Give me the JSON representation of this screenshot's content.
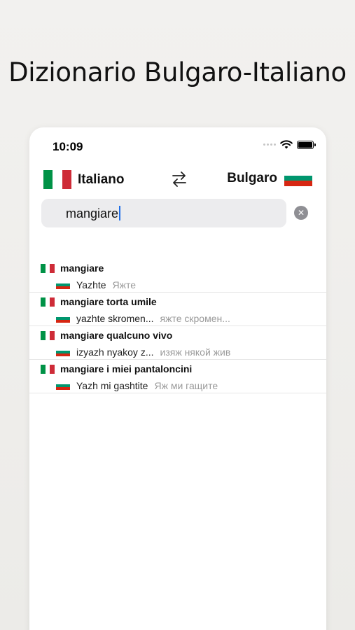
{
  "headline": "Dizionario Bulgaro-Italiano",
  "status_bar": {
    "time": "10:09"
  },
  "languages": {
    "source": {
      "name": "Italiano",
      "flag_colors": [
        "#009246",
        "#ffffff",
        "#ce2b37"
      ],
      "flag_icon": "italy-flag-icon"
    },
    "target": {
      "name": "Bulgaro",
      "flag_colors": [
        "#ffffff",
        "#00966e",
        "#d62612"
      ],
      "flag_icon": "bulgaria-flag-icon"
    },
    "swap_icon": "swap-arrows-icon"
  },
  "search": {
    "value": "mangiare",
    "clear_icon": "clear-icon"
  },
  "results": [
    {
      "term": "mangiare",
      "transliteration": "Yazhte",
      "cyrillic": "Яжте"
    },
    {
      "term": "mangiare torta umile",
      "transliteration": "yazhte skromen...",
      "cyrillic": "яжте скромен..."
    },
    {
      "term": "mangiare qualcuno vivo",
      "transliteration": "izyazh nyakoy z...",
      "cyrillic": "изяж някой жив"
    },
    {
      "term": "mangiare i miei pantaloncini",
      "transliteration": "Yazh mi gashtite",
      "cyrillic": "Яж ми гащите"
    }
  ],
  "colors": {
    "accent_caret": "#1f6fe8",
    "muted_text": "#9a9a9a",
    "search_bg": "#ececee"
  }
}
